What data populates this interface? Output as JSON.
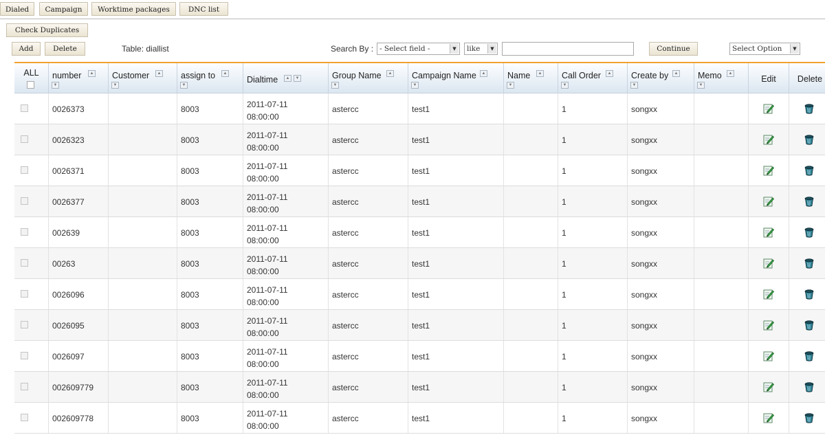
{
  "tabs": [
    "Dialed",
    "Campaign",
    "Worktime packages",
    "DNC list"
  ],
  "toolbar": {
    "check_duplicates": "Check Duplicates",
    "add": "Add",
    "delete": "Delete",
    "table_label": "Table: diallist",
    "search_by_label": "Search By :",
    "field_select": "- Select field -",
    "operator_select": "like",
    "search_value": "",
    "continue": "Continue",
    "option_select": "Select Option"
  },
  "columns": {
    "all": "ALL",
    "number": "number",
    "customer": "Customer",
    "assign_to": "assign to",
    "dialtime": "Dialtime",
    "group_name": "Group Name",
    "campaign_name": "Campaign Name",
    "name": "Name",
    "call_order": "Call Order",
    "create_by": "Create by",
    "memo": "Memo",
    "edit": "Edit",
    "delete": "Delete"
  },
  "rows": [
    {
      "number": "0026373",
      "customer": "",
      "assign_to": "8003",
      "date": "2011-07-11",
      "time": "08:00:00",
      "group": "astercc",
      "campaign": "test1",
      "name": "",
      "call_order": "1",
      "create_by": "songxx",
      "memo": ""
    },
    {
      "number": "0026323",
      "customer": "",
      "assign_to": "8003",
      "date": "2011-07-11",
      "time": "08:00:00",
      "group": "astercc",
      "campaign": "test1",
      "name": "",
      "call_order": "1",
      "create_by": "songxx",
      "memo": ""
    },
    {
      "number": "0026371",
      "customer": "",
      "assign_to": "8003",
      "date": "2011-07-11",
      "time": "08:00:00",
      "group": "astercc",
      "campaign": "test1",
      "name": "",
      "call_order": "1",
      "create_by": "songxx",
      "memo": ""
    },
    {
      "number": "0026377",
      "customer": "",
      "assign_to": "8003",
      "date": "2011-07-11",
      "time": "08:00:00",
      "group": "astercc",
      "campaign": "test1",
      "name": "",
      "call_order": "1",
      "create_by": "songxx",
      "memo": ""
    },
    {
      "number": "002639",
      "customer": "",
      "assign_to": "8003",
      "date": "2011-07-11",
      "time": "08:00:00",
      "group": "astercc",
      "campaign": "test1",
      "name": "",
      "call_order": "1",
      "create_by": "songxx",
      "memo": ""
    },
    {
      "number": "00263",
      "customer": "",
      "assign_to": "8003",
      "date": "2011-07-11",
      "time": "08:00:00",
      "group": "astercc",
      "campaign": "test1",
      "name": "",
      "call_order": "1",
      "create_by": "songxx",
      "memo": ""
    },
    {
      "number": "0026096",
      "customer": "",
      "assign_to": "8003",
      "date": "2011-07-11",
      "time": "08:00:00",
      "group": "astercc",
      "campaign": "test1",
      "name": "",
      "call_order": "1",
      "create_by": "songxx",
      "memo": ""
    },
    {
      "number": "0026095",
      "customer": "",
      "assign_to": "8003",
      "date": "2011-07-11",
      "time": "08:00:00",
      "group": "astercc",
      "campaign": "test1",
      "name": "",
      "call_order": "1",
      "create_by": "songxx",
      "memo": ""
    },
    {
      "number": "0026097",
      "customer": "",
      "assign_to": "8003",
      "date": "2011-07-11",
      "time": "08:00:00",
      "group": "astercc",
      "campaign": "test1",
      "name": "",
      "call_order": "1",
      "create_by": "songxx",
      "memo": ""
    },
    {
      "number": "002609779",
      "customer": "",
      "assign_to": "8003",
      "date": "2011-07-11",
      "time": "08:00:00",
      "group": "astercc",
      "campaign": "test1",
      "name": "",
      "call_order": "1",
      "create_by": "songxx",
      "memo": ""
    },
    {
      "number": "002609778",
      "customer": "",
      "assign_to": "8003",
      "date": "2011-07-11",
      "time": "08:00:00",
      "group": "astercc",
      "campaign": "test1",
      "name": "",
      "call_order": "1",
      "create_by": "songxx",
      "memo": ""
    }
  ],
  "icons": {
    "edit": "edit-pencil-icon",
    "delete": "trash-can-icon",
    "sort_up": "sort-asc-icon",
    "sort_down": "sort-desc-icon",
    "dropdown": "chevron-down-icon"
  },
  "colors": {
    "header_accent": "#f0a12f",
    "header_bg": "#dbe6f1",
    "button_bg": "#ebe4d2"
  }
}
